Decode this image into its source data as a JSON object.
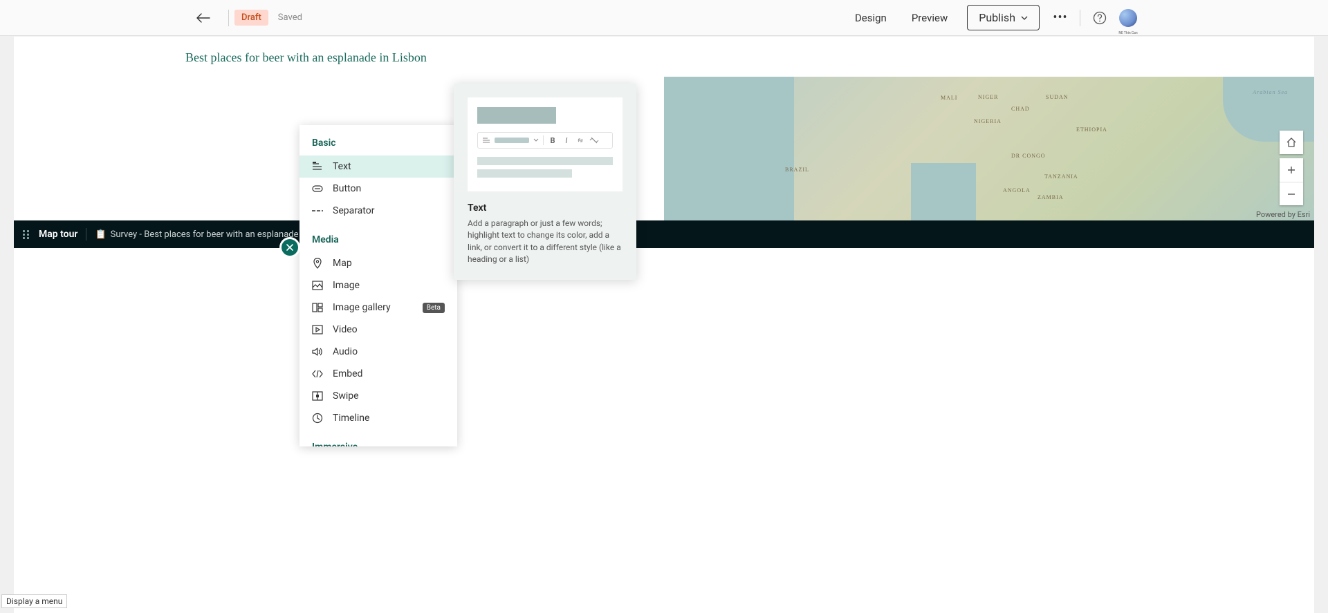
{
  "header": {
    "draft_badge": "Draft",
    "saved_label": "Saved",
    "design": "Design",
    "preview": "Preview",
    "publish": "Publish",
    "avatar_caption": "NE Thin Can"
  },
  "story": {
    "title": "Best places for beer with an esplanade in Lisbon"
  },
  "map": {
    "attribution": "Powered by Esri",
    "labels": [
      "Brazil",
      "Mali",
      "Niger",
      "Sudan",
      "Chad",
      "Nigeria",
      "Ethiopia",
      "DR Congo",
      "Tanzania",
      "Angola",
      "Zambia",
      "Arabian Sea"
    ]
  },
  "block_strip": {
    "title": "Map tour",
    "subtitle": "Survey - Best places for beer with an esplanade in Lisbon stake",
    "emoji": "📋"
  },
  "palette": {
    "sections": {
      "basic": "Basic",
      "media": "Media",
      "immersive": "Immersive"
    },
    "items": {
      "text": "Text",
      "button": "Button",
      "separator": "Separator",
      "map": "Map",
      "image": "Image",
      "image_gallery": "Image gallery",
      "video": "Video",
      "audio": "Audio",
      "embed": "Embed",
      "swipe": "Swipe",
      "timeline": "Timeline"
    },
    "beta_badge": "Beta"
  },
  "flyout": {
    "title": "Text",
    "description": "Add a paragraph or just a few words; highlight text to change its color, add a link, or convert it to a different style (like a heading or a list)"
  },
  "tooltip": {
    "menu": "Display a menu"
  }
}
